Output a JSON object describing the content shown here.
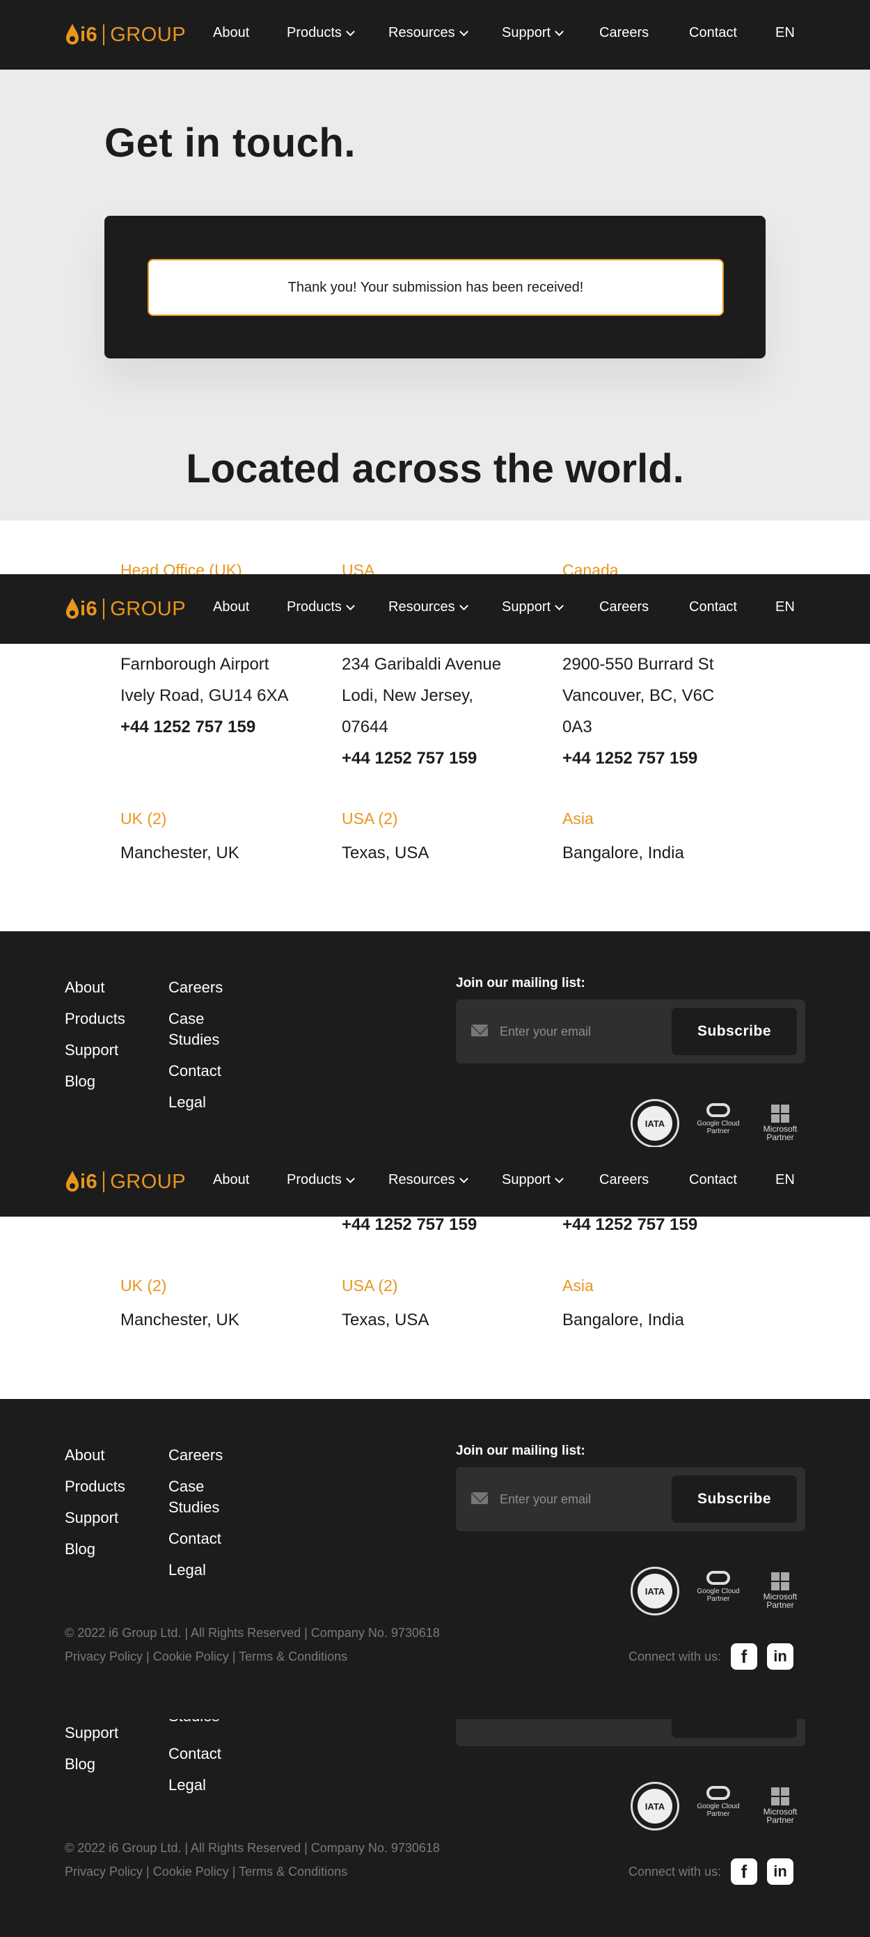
{
  "nav": {
    "logo_mark": "i6",
    "logo_word": "GROUP",
    "items": [
      {
        "label": "About"
      },
      {
        "label": "Products"
      },
      {
        "label": "Resources"
      },
      {
        "label": "Support"
      },
      {
        "label": "Careers"
      },
      {
        "label": "Contact"
      },
      {
        "label": "EN"
      }
    ]
  },
  "hero": {
    "title": "Get in touch.",
    "success_message": "Thank you! Your submission has been received!",
    "located_heading": "Located across the world."
  },
  "locations": [
    {
      "name": "Head Office (UK)",
      "lines": [
        "Farnborough Airport",
        "Ively Road, GU14 6XA"
      ],
      "phone": "+44 1252 757 159"
    },
    {
      "name": "USA",
      "lines": [
        "234 Garibaldi Avenue",
        "Lodi, New Jersey,",
        "07644"
      ],
      "phone": "+44 1252 757 159"
    },
    {
      "name": "Canada",
      "lines": [
        "2900-550 Burrard St",
        "Vancouver, BC, V6C",
        "0A3"
      ],
      "phone": "+44 1252 757 159"
    },
    {
      "name": "UK (2)",
      "lines": [
        "Manchester, UK"
      ]
    },
    {
      "name": "USA (2)",
      "lines": [
        "Texas, USA"
      ]
    },
    {
      "name": "Asia",
      "lines": [
        "Bangalore, India"
      ]
    }
  ],
  "footer": {
    "col1": [
      "About",
      "Products",
      "Support",
      "Blog"
    ],
    "col2": [
      "Careers",
      "Case",
      "Studies",
      "Contact",
      "Legal"
    ],
    "mailing_label": "Join our mailing list:",
    "email_placeholder": "Enter your email",
    "subscribe_label": "Subscribe",
    "badges": {
      "iata_text": "IATA",
      "google_line1": "Google Cloud",
      "google_line2": "Partner",
      "ms_line1": "Microsoft",
      "ms_line2": "Partner"
    },
    "copyright": "© 2022 i6 Group Ltd. | All Rights Reserved | Company No. 9730618",
    "policy_links": [
      "Privacy Policy",
      "Cookie Policy",
      "Terms & Conditions"
    ],
    "connect_label": "Connect with us:",
    "social": [
      {
        "icon": "facebook-icon",
        "glyph": "f"
      },
      {
        "icon": "linkedin-icon",
        "glyph": "in"
      }
    ]
  },
  "colors": {
    "accent": "#e8961e",
    "dark": "#1c1c1c",
    "light_bg": "#ebebeb"
  }
}
